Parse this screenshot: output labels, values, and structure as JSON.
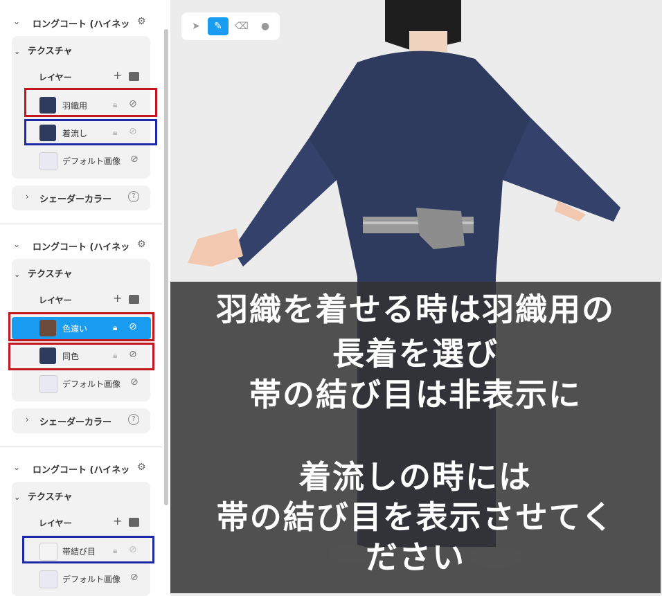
{
  "panel": {
    "sections": [
      {
        "title": "ロングコート (ハイネッ",
        "texture_label": "テクスチャ",
        "layer_label": "レイヤー",
        "layers": [
          "羽織用",
          "着流し",
          "デフォルト画像"
        ],
        "shader_label": "シェーダーカラー"
      },
      {
        "title": "ロングコート (ハイネッ",
        "texture_label": "テクスチャ",
        "layer_label": "レイヤー",
        "layers": [
          "色違い",
          "同色",
          "デフォルト画像"
        ],
        "shader_label": "シェーダーカラー"
      },
      {
        "title": "ロングコート (ハイネッ",
        "texture_label": "テクスチャ",
        "layer_label": "レイヤー",
        "layers": [
          "帯結び目",
          "デフォルト画像"
        ]
      }
    ],
    "selected_layer": "色違い"
  },
  "toolbar": {
    "tools": [
      "select-arrow-icon",
      "pen-icon",
      "eraser-icon",
      "droplet-icon"
    ],
    "active_tool": "pen-icon"
  },
  "caption": {
    "lines": [
      "羽織を着せる時は羽織用の",
      "長着を選び",
      "帯の結び目は非表示に",
      "",
      "着流しの時には",
      "帯の結び目を表示させてく",
      "ださい"
    ]
  },
  "colors": {
    "accent": "#1a9cf0",
    "highlight_red": "#c4161c",
    "highlight_blue": "#1c2aa8",
    "kimono": "#2e3a5e"
  }
}
